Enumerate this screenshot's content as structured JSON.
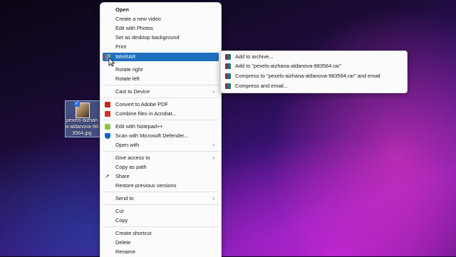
{
  "desktop": {
    "file_label": "pexels-aizhana-aldanova-983564.jpg"
  },
  "context_menu": {
    "items": [
      {
        "label": "Open"
      },
      {
        "label": "Create a new video"
      },
      {
        "label": "Edit with Photos"
      },
      {
        "label": "Set as desktop background"
      },
      {
        "label": "Print"
      },
      {
        "label": "WinRAR"
      },
      {
        "label": "Rotate right"
      },
      {
        "label": "Rotate left"
      },
      {
        "label": "Cast to Device"
      },
      {
        "label": "Convert to Adobe PDF"
      },
      {
        "label": "Combine files in Acrobat..."
      },
      {
        "label": "Edit with Notepad++"
      },
      {
        "label": "Scan with Microsoft Defender..."
      },
      {
        "label": "Open with"
      },
      {
        "label": "Give access to"
      },
      {
        "label": "Copy as path"
      },
      {
        "label": "Share"
      },
      {
        "label": "Restore previous versions"
      },
      {
        "label": "Send to"
      },
      {
        "label": "Cut"
      },
      {
        "label": "Copy"
      },
      {
        "label": "Create shortcut"
      },
      {
        "label": "Delete"
      },
      {
        "label": "Rename"
      }
    ]
  },
  "winrar_submenu": {
    "items": [
      {
        "label": "Add to archive..."
      },
      {
        "label": "Add to \"pexels-aizhana-aldanova-983564.rar\""
      },
      {
        "label": "Compress to \"pexels-aizhana-aldanova-983564.rar\" and email"
      },
      {
        "label": "Compress and email..."
      }
    ]
  },
  "colors": {
    "highlight": "#1f6fbf",
    "menu_bg": "#fbfbfb"
  }
}
